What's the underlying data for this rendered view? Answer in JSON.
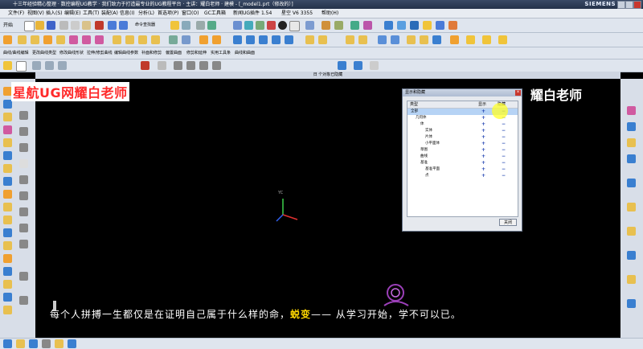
{
  "window": {
    "title": "十三年经验精心整理 · 数控编程UG教学 · 我们致力于打造最专业的UG教程平台 · 主讲：耀白老师 · 建模 - [_model1.prt（修改的）]",
    "brand": "SIEMENS"
  },
  "menu": {
    "items": [
      "文件(F)",
      "视图(V)",
      "插入(S)",
      "编辑(E)",
      "工具(T)",
      "装配(A)",
      "信息(I)",
      "分析(L)",
      "首选项(P)",
      "窗口(O)",
      "GC工具箱",
      "新闻UG插件 1.54",
      "星空 V6 3355",
      "帮助(H)"
    ]
  },
  "toolbar": {
    "start_label": "开始",
    "command_finder": "命令查找器",
    "row3": [
      "曲线/曲线编辑",
      "更改曲线类型",
      "修改曲线形状",
      "拉伸/修剪曲线",
      "编辑曲线参数",
      "补面和修剪",
      "偏置曲面",
      "修剪和延伸",
      "实用工具条",
      "曲线和曲面"
    ]
  },
  "view": {
    "title": "日 个对象已隐藏"
  },
  "overlay": {
    "watermark": "星航UG网耀白老师",
    "lecturer": "主讲：耀白老师",
    "subtitle_pre": "每个人拼搏一生都仅是在证明自己属于什么样的命，",
    "subtitle_hl": "蜕变",
    "subtitle_post": "—— 从学习开始，学不可以已。",
    "triad_label": "YC"
  },
  "dialog": {
    "title": "显示和隐藏",
    "col_type": "类型",
    "col_show": "显示",
    "col_hide": "隐藏",
    "rows": [
      {
        "name": "全部",
        "indent": 0
      },
      {
        "name": "几何体",
        "indent": 1
      },
      {
        "name": "体",
        "indent": 2
      },
      {
        "name": "实体",
        "indent": 3
      },
      {
        "name": "片体",
        "indent": 3
      },
      {
        "name": "小平面体",
        "indent": 3
      },
      {
        "name": "草图",
        "indent": 2
      },
      {
        "name": "曲线",
        "indent": 2
      },
      {
        "name": "基准",
        "indent": 2
      },
      {
        "name": "基准平面",
        "indent": 3
      },
      {
        "name": "点",
        "indent": 3
      }
    ],
    "plus_glyph": "+",
    "minus_glyph": "−",
    "close_button": "关闭",
    "x_glyph": "×"
  },
  "colors": {
    "watermark": "#ff2a2a",
    "subtitle_highlight": "#ffd700",
    "dialog_symbols": "#1c3fb0"
  }
}
